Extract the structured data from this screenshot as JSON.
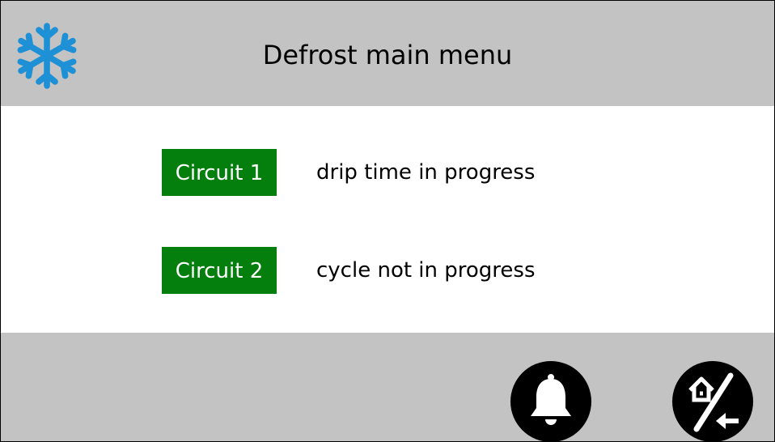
{
  "header": {
    "title": "Defrost main menu",
    "icon": "snowflake-icon",
    "icon_color": "#1e90d6"
  },
  "circuits": [
    {
      "label": "Circuit 1",
      "status": "drip time in progress"
    },
    {
      "label": "Circuit 2",
      "status": "cycle not in progress"
    }
  ],
  "footer": {
    "buttons": [
      {
        "icon": "bell-icon"
      },
      {
        "icon": "home-back-icon"
      }
    ]
  },
  "colors": {
    "bar_gray": "#c3c3c3",
    "circuit_green": "#047f0d",
    "button_black": "#000000"
  }
}
